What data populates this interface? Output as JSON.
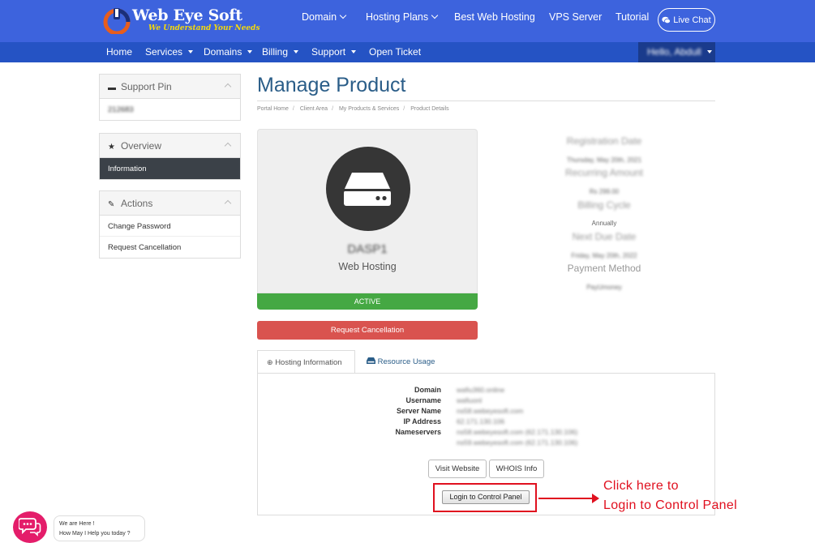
{
  "brand": {
    "name": "Web Eye Soft",
    "tagline": "We Understand Your Needs"
  },
  "topnav": {
    "domain": "Domain",
    "hosting_plans": "Hosting Plans",
    "best_web_hosting": "Best Web Hosting",
    "vps_server": "VPS Server",
    "tutorial": "Tutorial",
    "live_chat": "Live Chat"
  },
  "subnav": {
    "home": "Home",
    "services": "Services",
    "domains": "Domains",
    "billing": "Billing",
    "support": "Support",
    "open_ticket": "Open Ticket",
    "hello": "Hello, Abdull"
  },
  "sidebar": {
    "support_pin": {
      "title": "Support Pin",
      "value": "212683"
    },
    "overview": {
      "title": "Overview",
      "items": [
        "Information"
      ]
    },
    "actions": {
      "title": "Actions",
      "items": [
        "Change Password",
        "Request Cancellation"
      ]
    }
  },
  "page": {
    "title": "Manage Product",
    "breadcrumb": [
      "Portal Home",
      "Client Area",
      "My Products & Services",
      "Product Details"
    ]
  },
  "product": {
    "name": "DASP1",
    "group": "Web Hosting",
    "status": "ACTIVE",
    "cancel_button": "Request Cancellation"
  },
  "billing_info": {
    "registration_date_label": "Registration Date",
    "registration_date": "Thursday, May 20th, 2021",
    "recurring_amount_label": "Recurring Amount",
    "recurring_amount": "Rs 299.00",
    "billing_cycle_label": "Billing Cycle",
    "billing_cycle": "Annually",
    "next_due_date_label": "Next Due Date",
    "next_due_date": "Friday, May 20th, 2022",
    "payment_method_label": "Payment Method",
    "payment_method": "PayUmoney"
  },
  "tabs": {
    "hosting_information": "Hosting Information",
    "resource_usage": "Resource Usage"
  },
  "hosting": {
    "domain_label": "Domain",
    "domain": "wafiu360.online",
    "username_label": "Username",
    "username": "wafiuonl",
    "server_name_label": "Server Name",
    "server_name": "ns58.webeyesoft.com",
    "ip_address_label": "IP Address",
    "ip_address": "62.171.130.106",
    "nameservers_label": "Nameservers",
    "nameserver_1": "ns58.webeyesoft.com (62.171.130.106)",
    "nameserver_2": "ns59.webeyesoft.com (62.171.130.106)",
    "visit_website": "Visit Website",
    "whois_info": "WHOIS Info",
    "login_control_panel": "Login to Control Panel"
  },
  "annotation": {
    "line1": "Click here to",
    "line2": "Login to Control Panel"
  },
  "chat_widget": {
    "line1": "We are Here !",
    "line2": "How May I Help you today ?"
  },
  "colors": {
    "topbar": "#3d63dd",
    "subbar": "#2553c4",
    "title": "#2a5d88",
    "active": "#45a843",
    "danger": "#d9534f",
    "annotation": "#e0101f"
  }
}
